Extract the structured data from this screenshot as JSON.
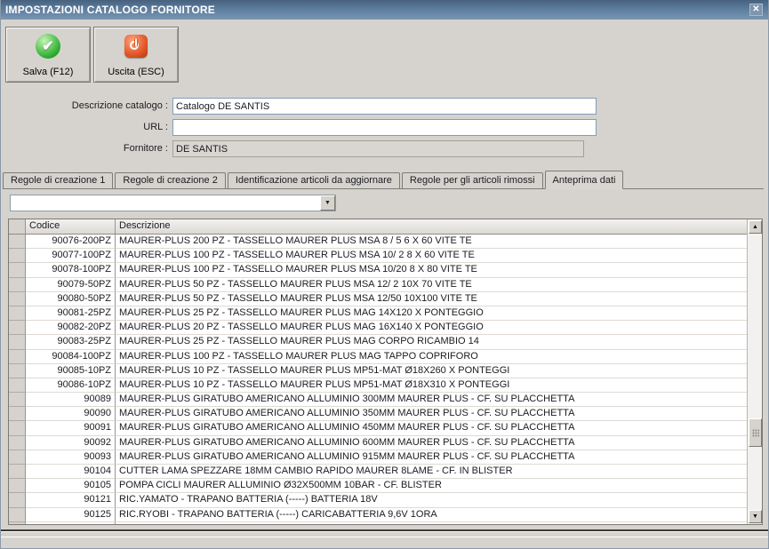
{
  "window": {
    "title": "IMPOSTAZIONI CATALOGO FORNITORE"
  },
  "toolbar": {
    "save_label": "Salva (F12)",
    "exit_label": "Uscita (ESC)"
  },
  "form": {
    "descrizione_label": "Descrizione catalogo :",
    "descrizione_value": "Catalogo DE SANTIS",
    "url_label": "URL :",
    "url_value": "",
    "fornitore_label": "Fornitore :",
    "fornitore_value": "DE SANTIS"
  },
  "tabs": [
    {
      "label": "Regole di creazione 1",
      "active": false
    },
    {
      "label": "Regole di creazione 2",
      "active": false
    },
    {
      "label": "Identificazione articoli da aggiornare",
      "active": false
    },
    {
      "label": "Regole per gli articoli rimossi",
      "active": false
    },
    {
      "label": "Anteprima dati",
      "active": true
    }
  ],
  "combo": {
    "value": ""
  },
  "table": {
    "columns": [
      "Codice",
      "Descrizione"
    ],
    "rows": [
      {
        "codice": "90076-200PZ",
        "descrizione": "MAURER-PLUS 200 PZ - TASSELLO MAURER PLUS MSA 8 / 5 6 X 60 VITE TE"
      },
      {
        "codice": "90077-100PZ",
        "descrizione": "MAURER-PLUS 100 PZ - TASSELLO MAURER PLUS MSA 10/ 2 8 X 60 VITE TE"
      },
      {
        "codice": "90078-100PZ",
        "descrizione": "MAURER-PLUS 100 PZ - TASSELLO MAURER PLUS MSA 10/20 8 X 80 VITE TE"
      },
      {
        "codice": "90079-50PZ",
        "descrizione": "MAURER-PLUS 50 PZ - TASSELLO MAURER PLUS MSA 12/ 2 10X 70 VITE TE"
      },
      {
        "codice": "90080-50PZ",
        "descrizione": "MAURER-PLUS 50 PZ - TASSELLO MAURER PLUS MSA 12/50 10X100 VITE TE"
      },
      {
        "codice": "90081-25PZ",
        "descrizione": "MAURER-PLUS 25 PZ - TASSELLO MAURER PLUS MAG 14X120 X PONTEGGIO"
      },
      {
        "codice": "90082-20PZ",
        "descrizione": "MAURER-PLUS 20 PZ - TASSELLO MAURER PLUS MAG 16X140 X PONTEGGIO"
      },
      {
        "codice": "90083-25PZ",
        "descrizione": "MAURER-PLUS 25 PZ - TASSELLO MAURER PLUS MAG CORPO RICAMBIO 14"
      },
      {
        "codice": "90084-100PZ",
        "descrizione": "MAURER-PLUS 100 PZ - TASSELLO MAURER PLUS MAG TAPPO COPRIFORO"
      },
      {
        "codice": "90085-10PZ",
        "descrizione": "MAURER-PLUS 10 PZ - TASSELLO MAURER PLUS MP51-MAT Ø18X260 X PONTEGGI"
      },
      {
        "codice": "90086-10PZ",
        "descrizione": "MAURER-PLUS 10 PZ - TASSELLO MAURER PLUS MP51-MAT Ø18X310 X PONTEGGI"
      },
      {
        "codice": "90089",
        "descrizione": "MAURER-PLUS GIRATUBO AMERICANO ALLUMINIO 300MM MAURER PLUS - CF. SU PLACCHETTA"
      },
      {
        "codice": "90090",
        "descrizione": "MAURER-PLUS GIRATUBO AMERICANO ALLUMINIO 350MM MAURER PLUS - CF. SU PLACCHETTA"
      },
      {
        "codice": "90091",
        "descrizione": "MAURER-PLUS GIRATUBO AMERICANO ALLUMINIO 450MM MAURER PLUS - CF. SU PLACCHETTA"
      },
      {
        "codice": "90092",
        "descrizione": "MAURER-PLUS GIRATUBO AMERICANO ALLUMINIO 600MM MAURER PLUS - CF. SU PLACCHETTA"
      },
      {
        "codice": "90093",
        "descrizione": "MAURER-PLUS GIRATUBO AMERICANO ALLUMINIO 915MM MAURER PLUS - CF. SU PLACCHETTA"
      },
      {
        "codice": "90104",
        "descrizione": "CUTTER LAMA SPEZZARE 18MM CAMBIO RAPIDO MAURER 8LAME - CF. IN BLISTER"
      },
      {
        "codice": "90105",
        "descrizione": "POMPA CICLI MAURER ALLUMINIO Ø32X500MM 10BAR - CF. BLISTER"
      },
      {
        "codice": "90121",
        "descrizione": "RIC.YAMATO - TRAPANO BATTERIA (-----) BATTERIA 18V"
      },
      {
        "codice": "90125",
        "descrizione": "RIC.RYOBI - TRAPANO BATTERIA (-----) CARICABATTERIA 9,6V 1ORA"
      }
    ]
  },
  "colors": {
    "titlebar": "#5c7c9e",
    "save_icon_green": "#2eb02e",
    "exit_icon_red": "#d9481c",
    "dialog_bg": "#d6d3ce"
  }
}
